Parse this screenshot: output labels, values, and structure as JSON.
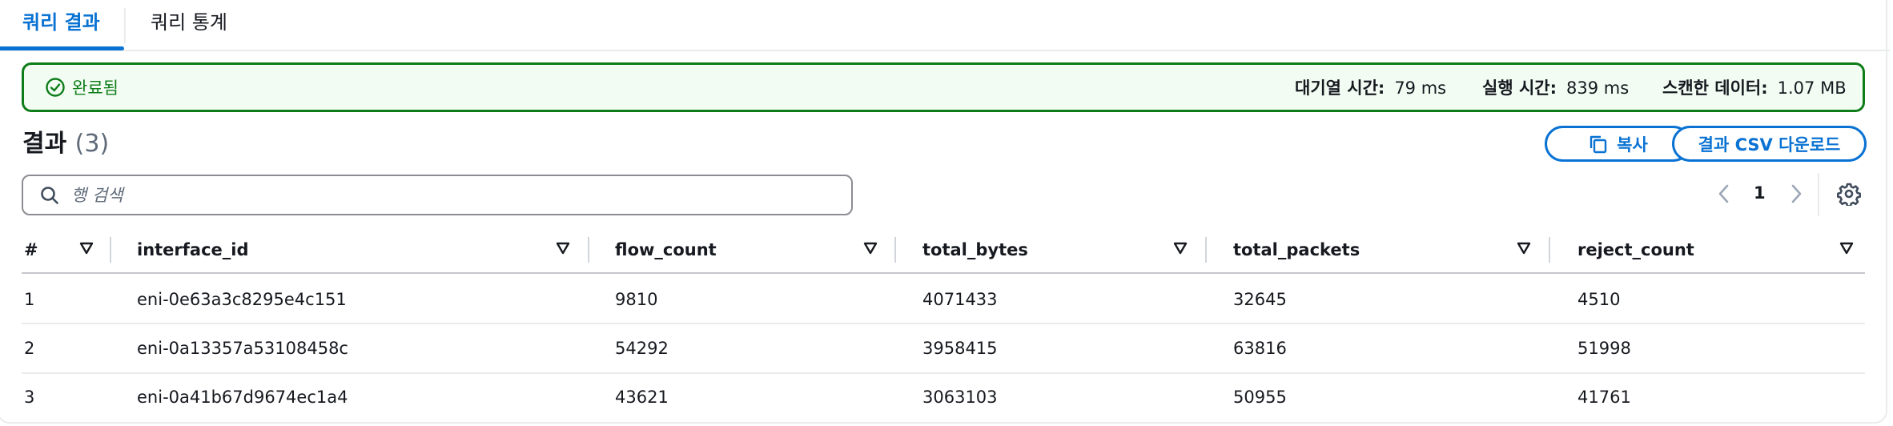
{
  "tabs": [
    {
      "label": "쿼리 결과",
      "active": true
    },
    {
      "label": "쿼리 통계",
      "active": false
    }
  ],
  "status": {
    "text": "완료됨",
    "color": "#0e7d19",
    "queue_label": "대기열 시간:",
    "queue_value": "79 ms",
    "run_label": "실행 시간:",
    "run_value": "839 ms",
    "scanned_label": "스캔한 데이터:",
    "scanned_value": "1.07 MB"
  },
  "results": {
    "title": "결과",
    "count": "(3)"
  },
  "actions": {
    "copy_label": "복사",
    "download_label": "결과 CSV 다운로드"
  },
  "search": {
    "placeholder": "행 검색",
    "value": ""
  },
  "pagination": {
    "current_page": "1"
  },
  "table": {
    "columns": [
      "#",
      "interface_id",
      "flow_count",
      "total_bytes",
      "total_packets",
      "reject_count"
    ],
    "rows": [
      [
        "1",
        "eni-0e63a3c8295e4c151",
        "9810",
        "4071433",
        "32645",
        "4510"
      ],
      [
        "2",
        "eni-0a13357a53108458c",
        "54292",
        "3958415",
        "63816",
        "51998"
      ],
      [
        "3",
        "eni-0a41b67d9674ec1a4",
        "43621",
        "3063103",
        "50955",
        "41761"
      ]
    ]
  },
  "colors": {
    "accent": "#0972d3",
    "success": "#0e7d19",
    "success_bg": "#f2fcf3"
  },
  "icons": [
    "check-circle-icon",
    "copy-icon",
    "search-icon",
    "chevron-left-icon",
    "chevron-right-icon",
    "settings-gear-icon",
    "sort-triangle-icon"
  ]
}
